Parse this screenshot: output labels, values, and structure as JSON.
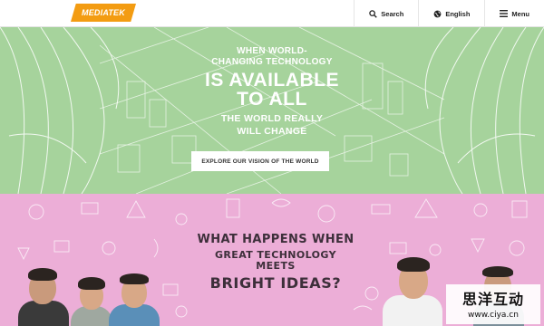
{
  "header": {
    "logo_text": "MEDIATEK",
    "nav": [
      {
        "label": "Search",
        "icon": "search-icon"
      },
      {
        "label": "English",
        "icon": "globe-icon"
      },
      {
        "label": "Menu",
        "icon": "hamburger-icon"
      }
    ]
  },
  "hero": {
    "lines": [
      "WHEN WORLD-",
      "CHANGING TECHNOLOGY",
      "IS AVAILABLE",
      "TO ALL",
      "THE WORLD REALLY",
      "WILL CHANGE"
    ],
    "cta_label": "EXPLORE OUR VISION OF THE WORLD",
    "bg_color": "#a6d39c"
  },
  "ideas": {
    "lines": [
      "WHAT HAPPENS WHEN",
      "GREAT TECHNOLOGY MEETS",
      "BRIGHT IDEAS?"
    ],
    "bg_color": "#ecaed7"
  },
  "watermark": {
    "chinese": "思洋互动",
    "url": "www.ciya.cn"
  },
  "colors": {
    "brand": "#f39c12"
  }
}
